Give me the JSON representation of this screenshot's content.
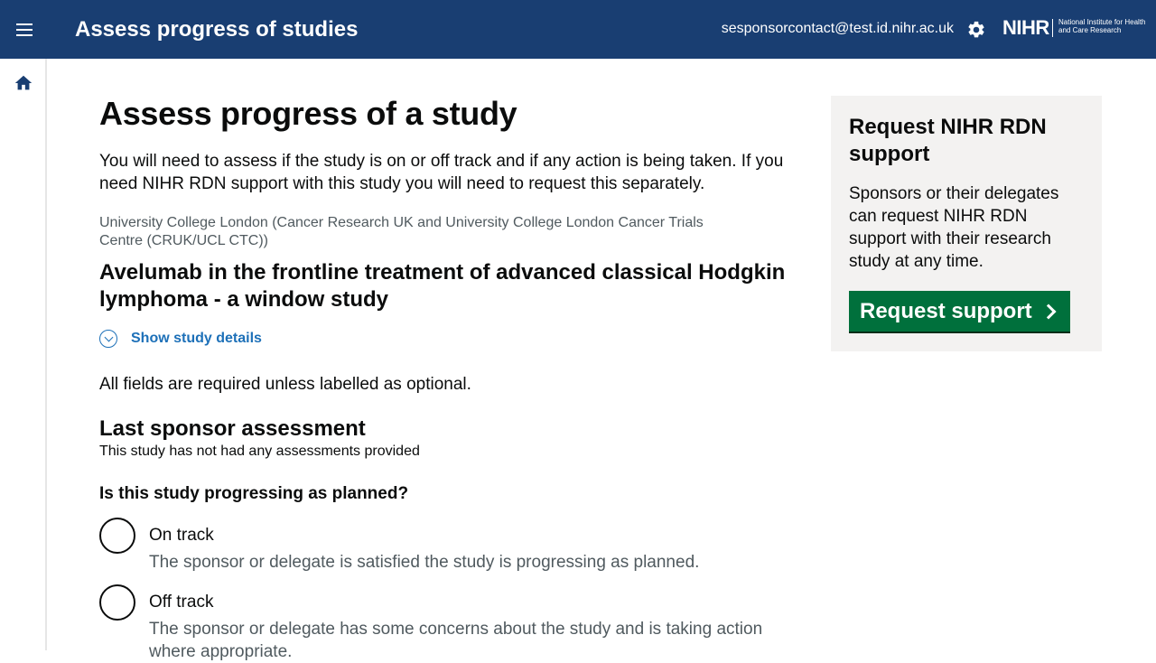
{
  "header": {
    "app_title": "Assess progress of studies",
    "user_email": "sesponsorcontact@test.id.nihr.ac.uk",
    "logo_text": "NIHR",
    "logo_subtext": "National Institute for Health and Care Research",
    "menu_icon": "menu-icon",
    "settings_icon": "gear-icon"
  },
  "sidenav": {
    "home_icon": "home-icon"
  },
  "main": {
    "page_title": "Assess progress of a study",
    "intro": "You will need to assess if the study is on or off track and if any action is being taken. If you need NIHR RDN support with this study you will need to request this separately.",
    "organisation": "University College London (Cancer Research UK and University College London Cancer Trials Centre (CRUK/UCL CTC))",
    "study_title": "Avelumab in the frontline treatment of advanced classical Hodgkin lymphoma - a window study",
    "show_details_label": "Show study details",
    "required_note": "All fields are required unless labelled as optional.",
    "last_assessment_heading": "Last sponsor assessment",
    "no_assessments": "This study has not had any assessments provided",
    "question": "Is this study progressing as planned?",
    "options": [
      {
        "label": "On track",
        "hint": "The sponsor or delegate is satisfied the study is progressing as planned."
      },
      {
        "label": "Off track",
        "hint": "The sponsor or delegate has some concerns about the study and is taking action where appropriate."
      }
    ]
  },
  "aside": {
    "title": "Request NIHR RDN support",
    "text": "Sponsors or their delegates can request NIHR RDN support with their research study at any time.",
    "button_label": "Request support"
  },
  "colors": {
    "header_bg": "#193e72",
    "button_green": "#00703c",
    "link_blue": "#1d70b8",
    "aside_bg": "#f3f2f1"
  }
}
